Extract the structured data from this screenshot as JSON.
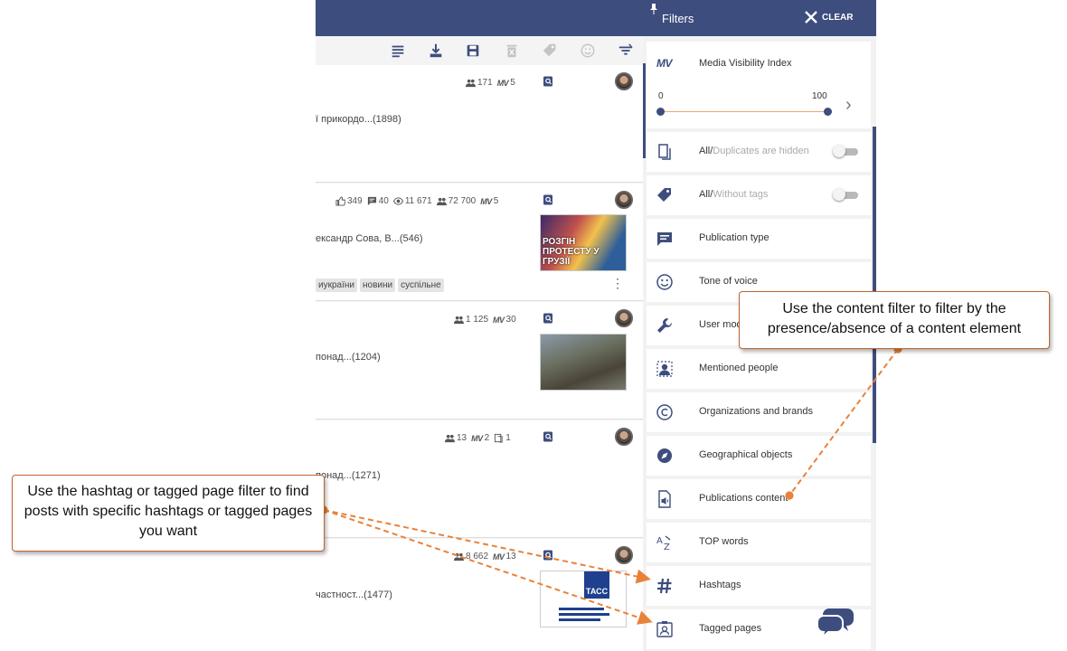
{
  "feed": {
    "posts": [
      {
        "text": "ї прикордо...(1898)",
        "stats": {
          "audience": "171",
          "mv": "5"
        }
      },
      {
        "text": "ександр Сова, В...(546)",
        "stats": {
          "likes": "349",
          "comments": "40",
          "views": "11 671",
          "audience": "72 700",
          "mv": "5"
        },
        "tags": [
          "иукраїни",
          "новини",
          "суспільне"
        ],
        "image_caption": "РОЗГІН ПРОТЕСТУ У ГРУЗІЇ"
      },
      {
        "text": "понад...(1204)",
        "stats": {
          "audience": "1 125",
          "mv": "30"
        }
      },
      {
        "text": "понад...(1271)",
        "stats": {
          "audience": "13",
          "mv": "2",
          "duplicates": "1"
        }
      },
      {
        "text": "частност...(1477)",
        "stats": {
          "audience": "8 662",
          "mv": "13"
        },
        "image_logo": "ТАСС"
      }
    ],
    "mv_label": "MV"
  },
  "filters": {
    "title": "Filters",
    "clear_label": "CLEAR",
    "mv": {
      "badge": "MV",
      "title": "Media Visibility Index",
      "min": "0",
      "max": "100",
      "chevron": "›"
    },
    "duplicates": {
      "all": "All/",
      "rest": "Duplicates are hidden"
    },
    "tags_toggle": {
      "all": "All/",
      "rest": "Without tags"
    },
    "items": [
      "Publication type",
      "Tone of voice",
      "User mod",
      "Mentioned people",
      "Organizations and brands",
      "Geographical objects",
      "Publications content",
      "TOP words",
      "Hashtags",
      "Tagged pages"
    ]
  },
  "callouts": {
    "content": "Use the content filter to filter by the presence/absence of a content element",
    "hashtag": "Use the hashtag or tagged page filter to find posts with specific hashtags or tagged pages you want"
  },
  "colors": {
    "brand_navy": "#3d4d7e",
    "callout_border": "#c0632b",
    "arrow": "#e8823a"
  }
}
